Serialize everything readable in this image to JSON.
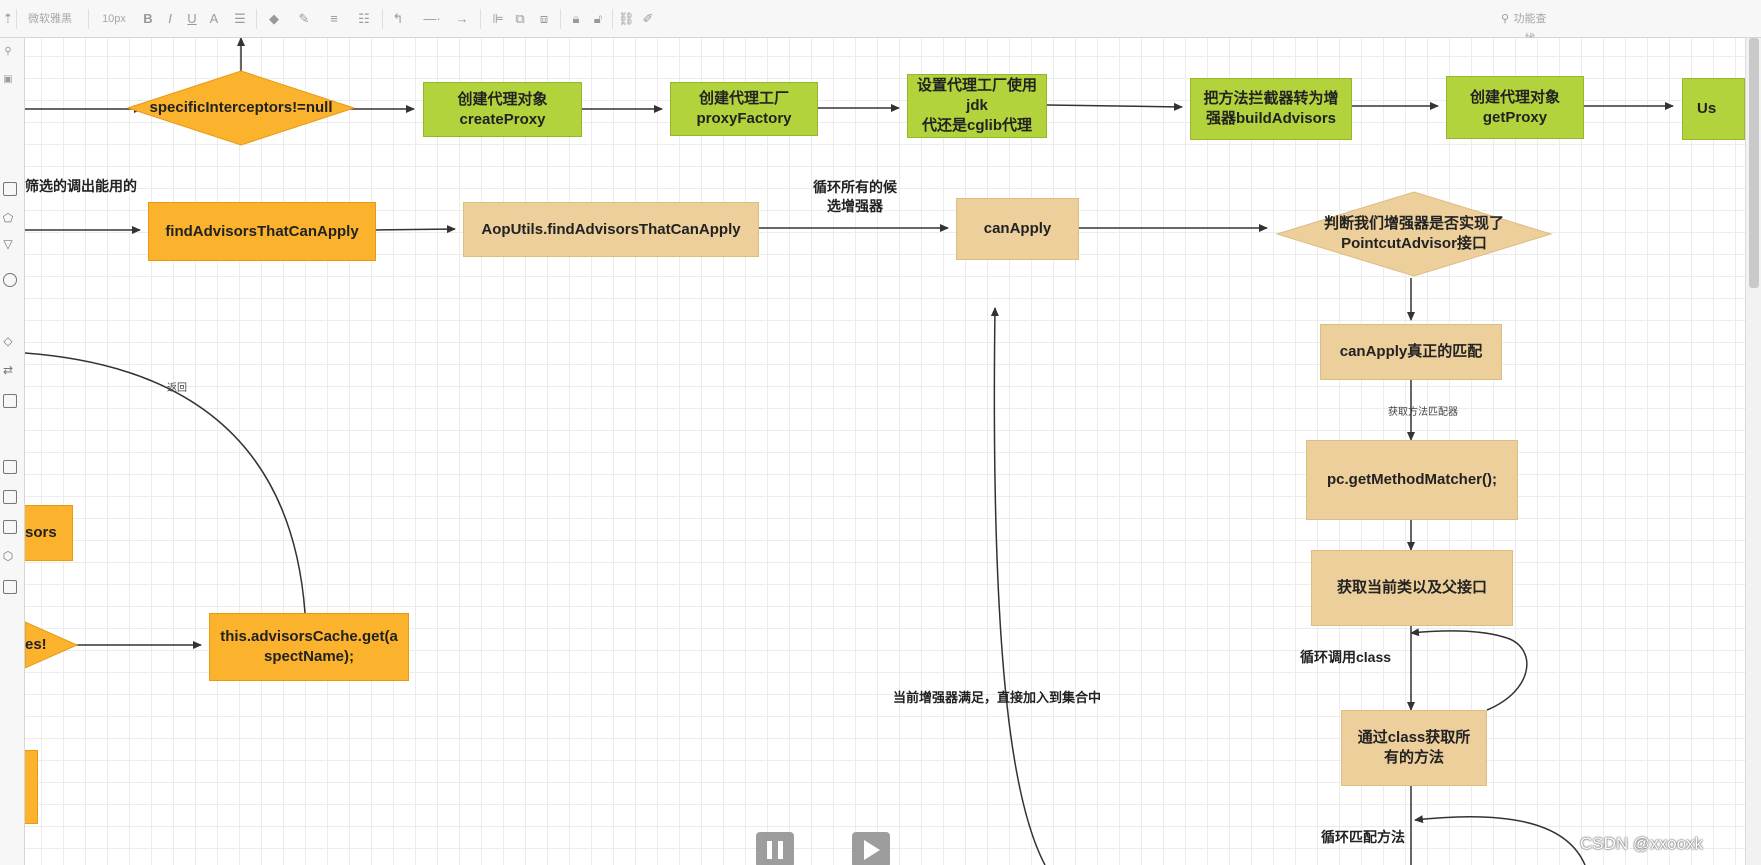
{
  "toolbar": {
    "font_family": "微软雅黑",
    "font_size": "10px",
    "search_label": "功能查找"
  },
  "colors": {
    "green": "#b3d33d",
    "orange": "#fbb22c",
    "tan": "#eccf9b",
    "grid": "#ececec"
  },
  "nodes": {
    "specific_interceptors": "specificInterceptors!=null",
    "create_proxy": "创建代理对象\ncreateProxy",
    "proxy_factory": "创建代理工厂\nproxyFactory",
    "set_proxy_factory": "设置代理工厂使用jdk\n代还是cglib代理",
    "build_advisors": "把方法拦截器转为增\n强器buildAdvisors",
    "get_proxy": "创建代理对象\ngetProxy",
    "us_partial": "Us",
    "find_advisors_that_can_apply": "findAdvisorsThatCanApply",
    "aop_utils_find": "AopUtils.findAdvisorsThatCanApply",
    "can_apply": "canApply",
    "is_pointcut_advisor": "判断我们增强器是否实现了\nPointcutAdvisor接口",
    "can_apply_real_match": "canApply真正的匹配",
    "get_method_matcher": "pc.getMethodMatcher();",
    "get_current_class": "获取当前类以及父接口",
    "get_all_methods": "通过class获取所\n有的方法",
    "advisors_cache_get": "this.advisorsCache.get(a\nspectName);",
    "left_sors_partial": "sors",
    "left_es_partial": "es!"
  },
  "edge_labels": {
    "call_usable": "筛选的调出能用的",
    "loop_candidates": "循环所有的候\n选增强器",
    "return": "返回",
    "get_method_matcher_label": "获取方法匹配器",
    "loop_call_class": "循环调用class",
    "add_to_set": "当前增强器满足，直接加入到集合中",
    "loop_match_methods": "循环匹配方法"
  },
  "watermark": "CSDN @xxooxk"
}
